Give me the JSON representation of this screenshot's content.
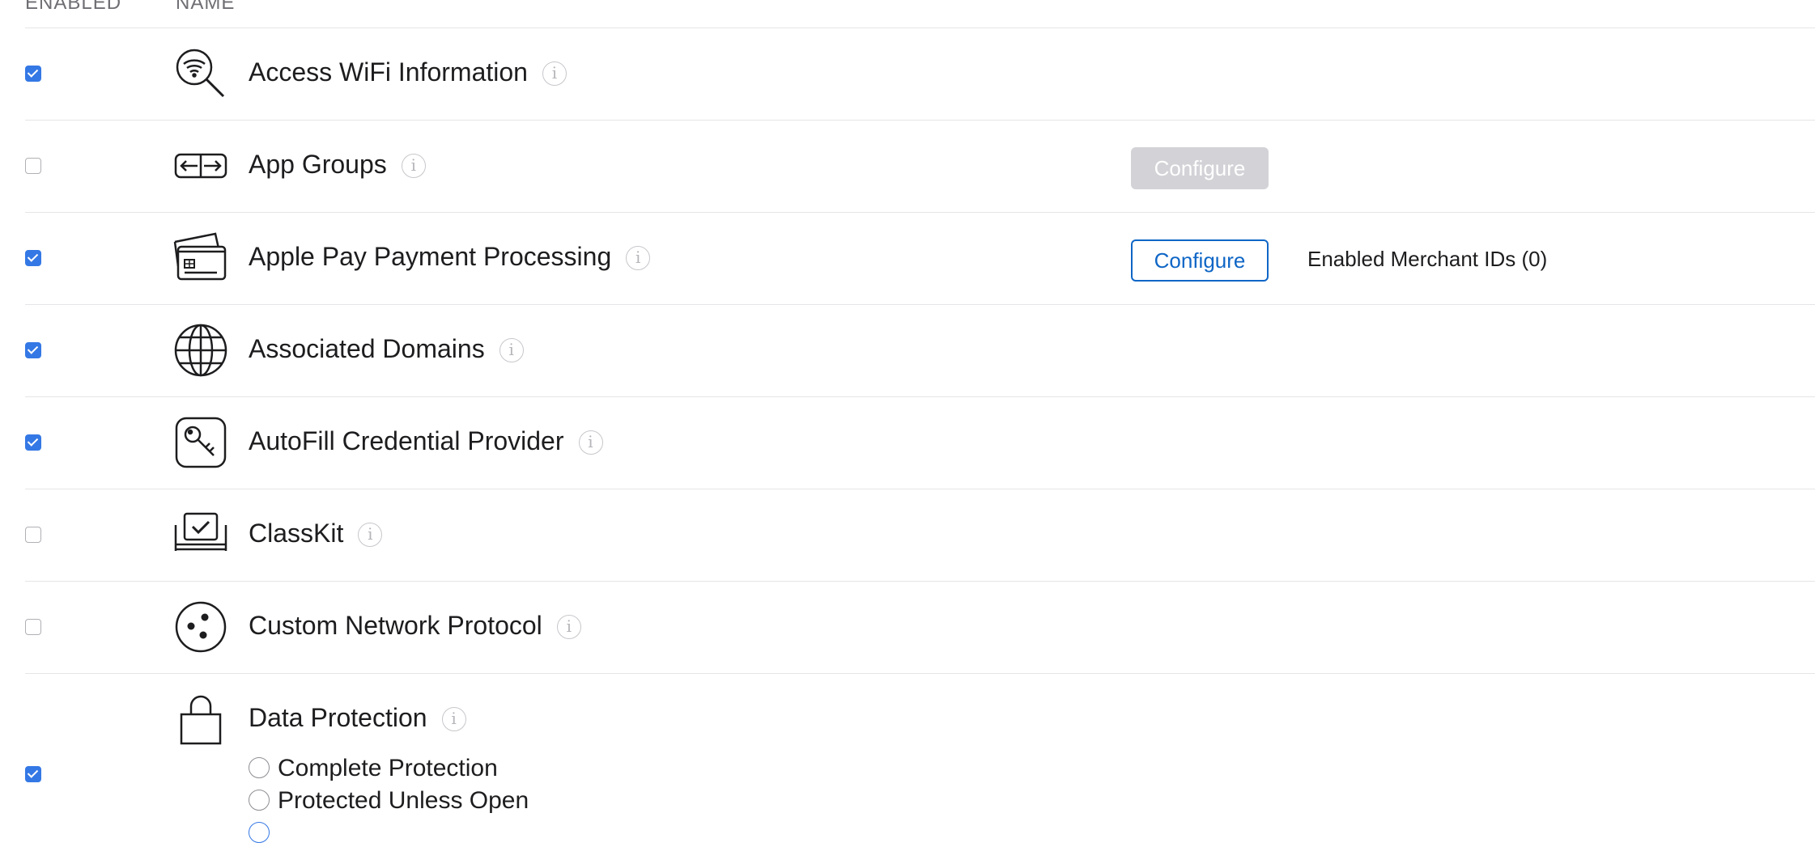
{
  "header": {
    "enabled_col": "ENABLED",
    "name_col": "NAME"
  },
  "rows": [
    {
      "name": "Access WiFi Information",
      "enabled": true,
      "icon": "wifi-search-icon"
    },
    {
      "name": "App Groups",
      "enabled": false,
      "icon": "app-groups-icon",
      "button": "Configure",
      "button_state": "disabled"
    },
    {
      "name": "Apple Pay Payment Processing",
      "enabled": true,
      "icon": "credit-cards-icon",
      "button": "Configure",
      "button_state": "active",
      "extra": "Enabled Merchant IDs (0)"
    },
    {
      "name": "Associated Domains",
      "enabled": true,
      "icon": "globe-icon"
    },
    {
      "name": "AutoFill Credential Provider",
      "enabled": true,
      "icon": "key-icon"
    },
    {
      "name": "ClassKit",
      "enabled": false,
      "icon": "classkit-icon"
    },
    {
      "name": "Custom Network Protocol",
      "enabled": false,
      "icon": "network-protocol-icon"
    },
    {
      "name": "Data Protection",
      "enabled": true,
      "icon": "lock-icon",
      "options": [
        "Complete Protection",
        "Protected Unless Open"
      ]
    }
  ],
  "info_glyph": "i",
  "colors": {
    "accent": "#0f66c6",
    "checkbox": "#3478e5",
    "divider": "#e5e5e7"
  }
}
